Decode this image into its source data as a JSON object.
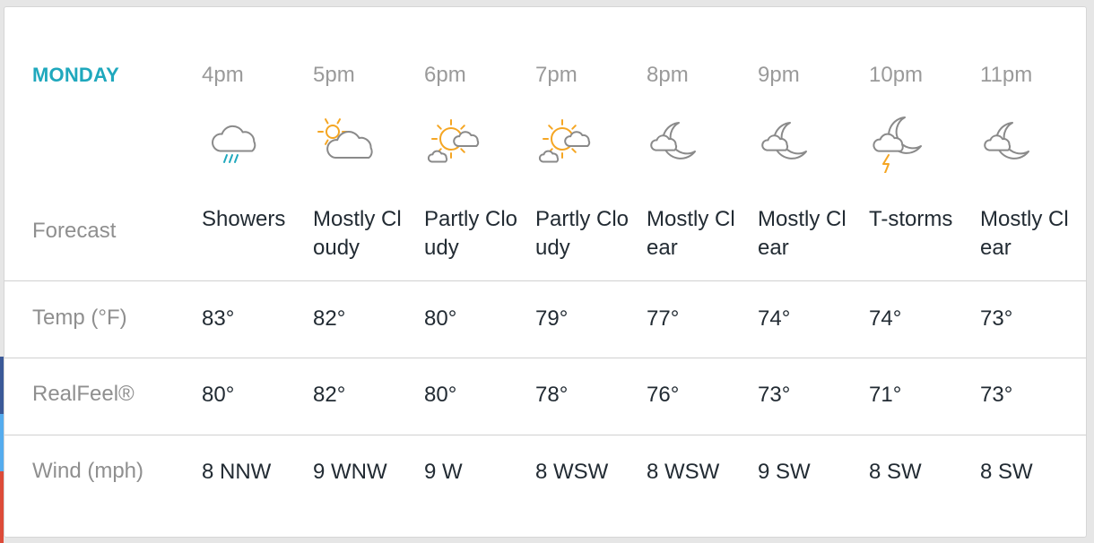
{
  "day": "MONDAY",
  "row_labels": {
    "forecast": "Forecast",
    "temp": "Temp (°F)",
    "realfeel": "RealFeel®",
    "wind": "Wind (mph)"
  },
  "colors": {
    "accent": "#1fa8bd",
    "sun": "#f5a623",
    "cloud": "#8a8a8a",
    "rain": "#1fa8bd",
    "label": "#8f8f8f",
    "value": "#222b33"
  },
  "hours": [
    {
      "time": "4pm",
      "icon": "rain-shower-icon",
      "condition": "Showers",
      "temp": "83°",
      "realfeel": "80°",
      "wind": "8 NNW"
    },
    {
      "time": "5pm",
      "icon": "mostly-cloudy-day-icon",
      "condition": "Mostly Cloudy",
      "temp": "82°",
      "realfeel": "82°",
      "wind": "9 WNW"
    },
    {
      "time": "6pm",
      "icon": "partly-cloudy-day-icon",
      "condition": "Partly Cloudy",
      "temp": "80°",
      "realfeel": "80°",
      "wind": "9 W"
    },
    {
      "time": "7pm",
      "icon": "partly-cloudy-day-icon",
      "condition": "Partly Cloudy",
      "temp": "79°",
      "realfeel": "78°",
      "wind": "8 WSW"
    },
    {
      "time": "8pm",
      "icon": "mostly-clear-night-icon",
      "condition": "Mostly Clear",
      "temp": "77°",
      "realfeel": "76°",
      "wind": "8 WSW"
    },
    {
      "time": "9pm",
      "icon": "mostly-clear-night-icon",
      "condition": "Mostly Clear",
      "temp": "74°",
      "realfeel": "73°",
      "wind": "9 SW"
    },
    {
      "time": "10pm",
      "icon": "thunderstorm-night-icon",
      "condition": "T-storms",
      "temp": "74°",
      "realfeel": "71°",
      "wind": "8 SW"
    },
    {
      "time": "11pm",
      "icon": "mostly-clear-night-icon",
      "condition": "Mostly Clear",
      "temp": "73°",
      "realfeel": "73°",
      "wind": "8 SW"
    }
  ]
}
